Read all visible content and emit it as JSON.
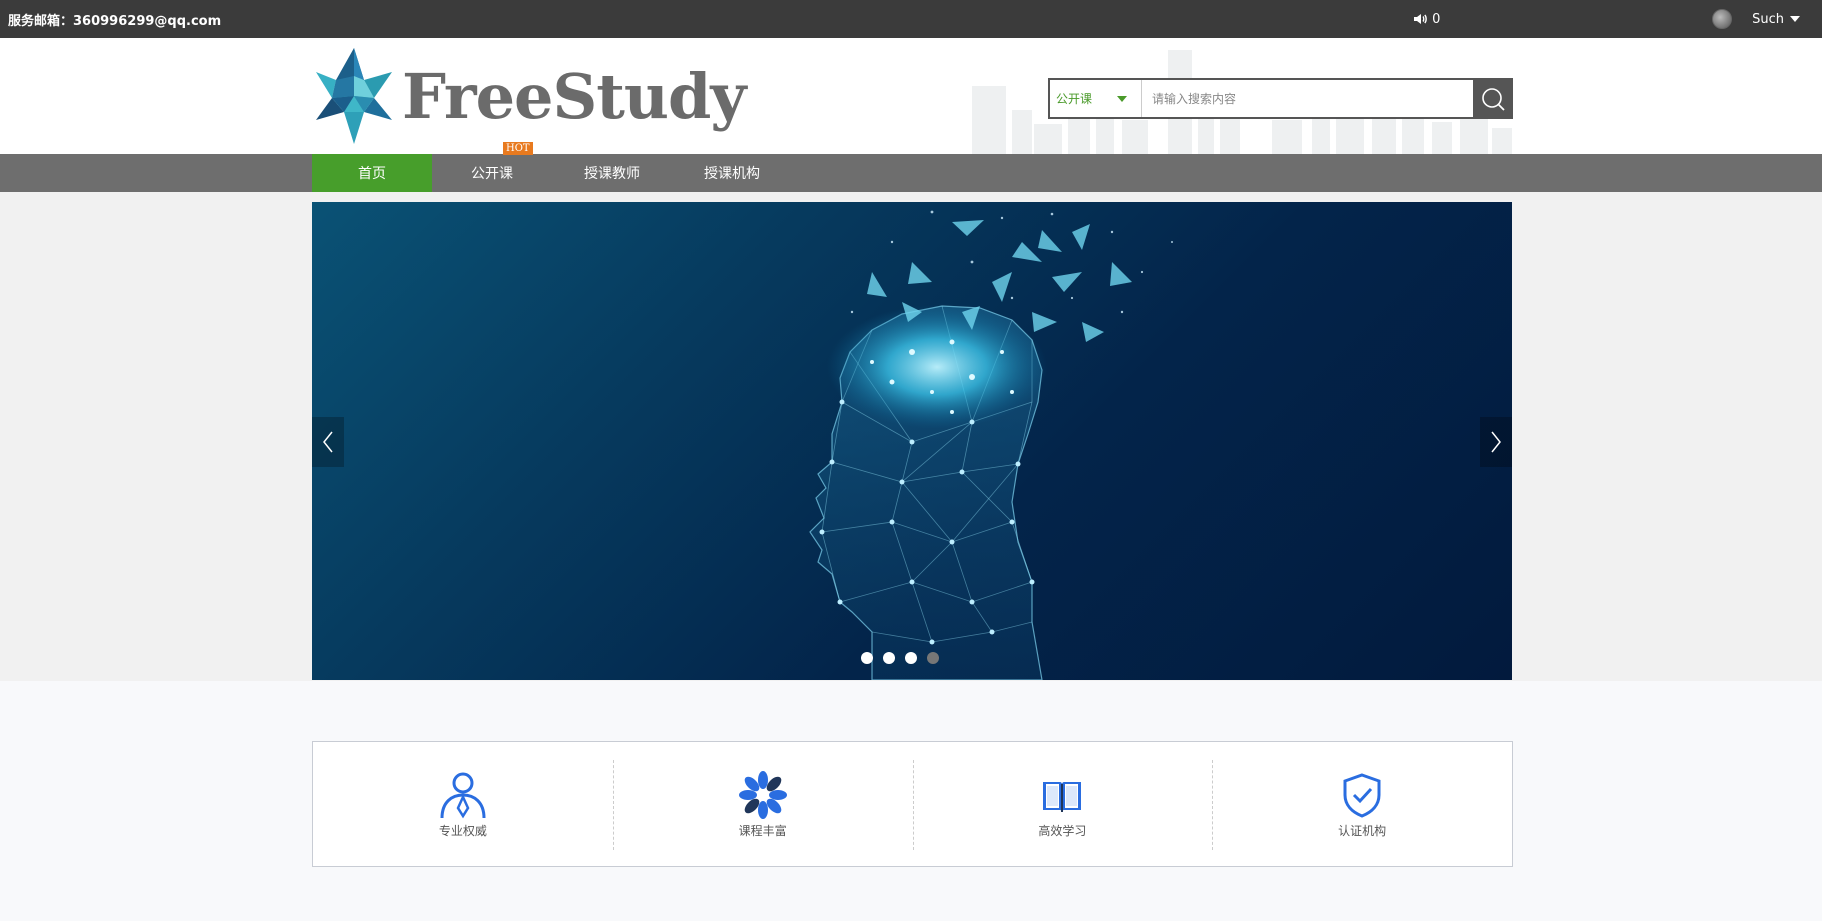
{
  "topbar": {
    "email": "服务邮箱：360996299@qq.com",
    "notifications": "0",
    "username": "Such"
  },
  "header": {
    "logo_text": "FreeStudy",
    "search": {
      "category": "公开课",
      "placeholder": "请输入搜索内容"
    }
  },
  "nav": {
    "items": [
      {
        "label": "首页",
        "active": true
      },
      {
        "label": "公开课",
        "active": false
      },
      {
        "label": "授课教师",
        "active": false
      },
      {
        "label": "授课机构",
        "active": false
      }
    ],
    "hot_badge": "HOT"
  },
  "banner": {
    "slide_count": 4,
    "current_slide": 4
  },
  "features": [
    {
      "label": "专业权威",
      "icon": "person-tie-icon"
    },
    {
      "label": "课程丰富",
      "icon": "flower-icon"
    },
    {
      "label": "高效学习",
      "icon": "book-icon"
    },
    {
      "label": "认证机构",
      "icon": "shield-check-icon"
    }
  ],
  "colors": {
    "topbar": "#3b3b3b",
    "nav": "#6e6e6e",
    "nav_active": "#479e2b",
    "hot": "#e87a1f",
    "feature_icon": "#2a6de0"
  }
}
